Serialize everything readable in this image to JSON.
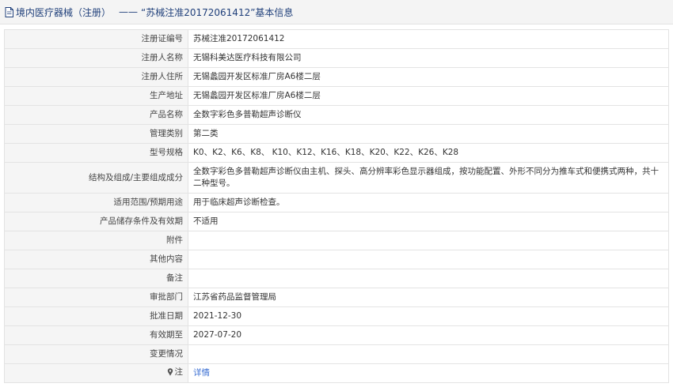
{
  "header": {
    "prefix": "境内医疗器械（注册）",
    "separator": "——",
    "title": "“苏械注准20172061412”基本信息"
  },
  "rows": [
    {
      "label": "注册证编号",
      "value": "苏械注准20172061412"
    },
    {
      "label": "注册人名称",
      "value": "无锡科美达医疗科技有限公司"
    },
    {
      "label": "注册人住所",
      "value": "无锡蠡园开发区标准厂房A6楼二层"
    },
    {
      "label": "生产地址",
      "value": "无锡蠡园开发区标准厂房A6楼二层"
    },
    {
      "label": "产品名称",
      "value": "全数字彩色多普勒超声诊断仪"
    },
    {
      "label": "管理类别",
      "value": "第二类"
    },
    {
      "label": "型号规格",
      "value": "K0、K2、K6、K8、 K10、K12、K16、K18、K20、K22、K26、K28"
    },
    {
      "label": "结构及组成/主要组成成分",
      "value": "全数字彩色多普勒超声诊断仪由主机、探头、高分辨率彩色显示器组成，按功能配置、外形不同分为推车式和便携式两种，共十二种型号。"
    },
    {
      "label": "适用范围/预期用途",
      "value": "用于临床超声诊断检查。"
    },
    {
      "label": "产品储存条件及有效期",
      "value": "不适用"
    },
    {
      "label": "附件",
      "value": ""
    },
    {
      "label": "其他内容",
      "value": ""
    },
    {
      "label": "备注",
      "value": ""
    },
    {
      "label": "审批部门",
      "value": "江苏省药品监督管理局"
    },
    {
      "label": "批准日期",
      "value": "2021-12-30"
    },
    {
      "label": "有效期至",
      "value": "2027-07-20"
    },
    {
      "label": "变更情况",
      "value": ""
    }
  ],
  "note": {
    "label": "注",
    "link_text": "详情",
    "icon": "pin-icon"
  }
}
